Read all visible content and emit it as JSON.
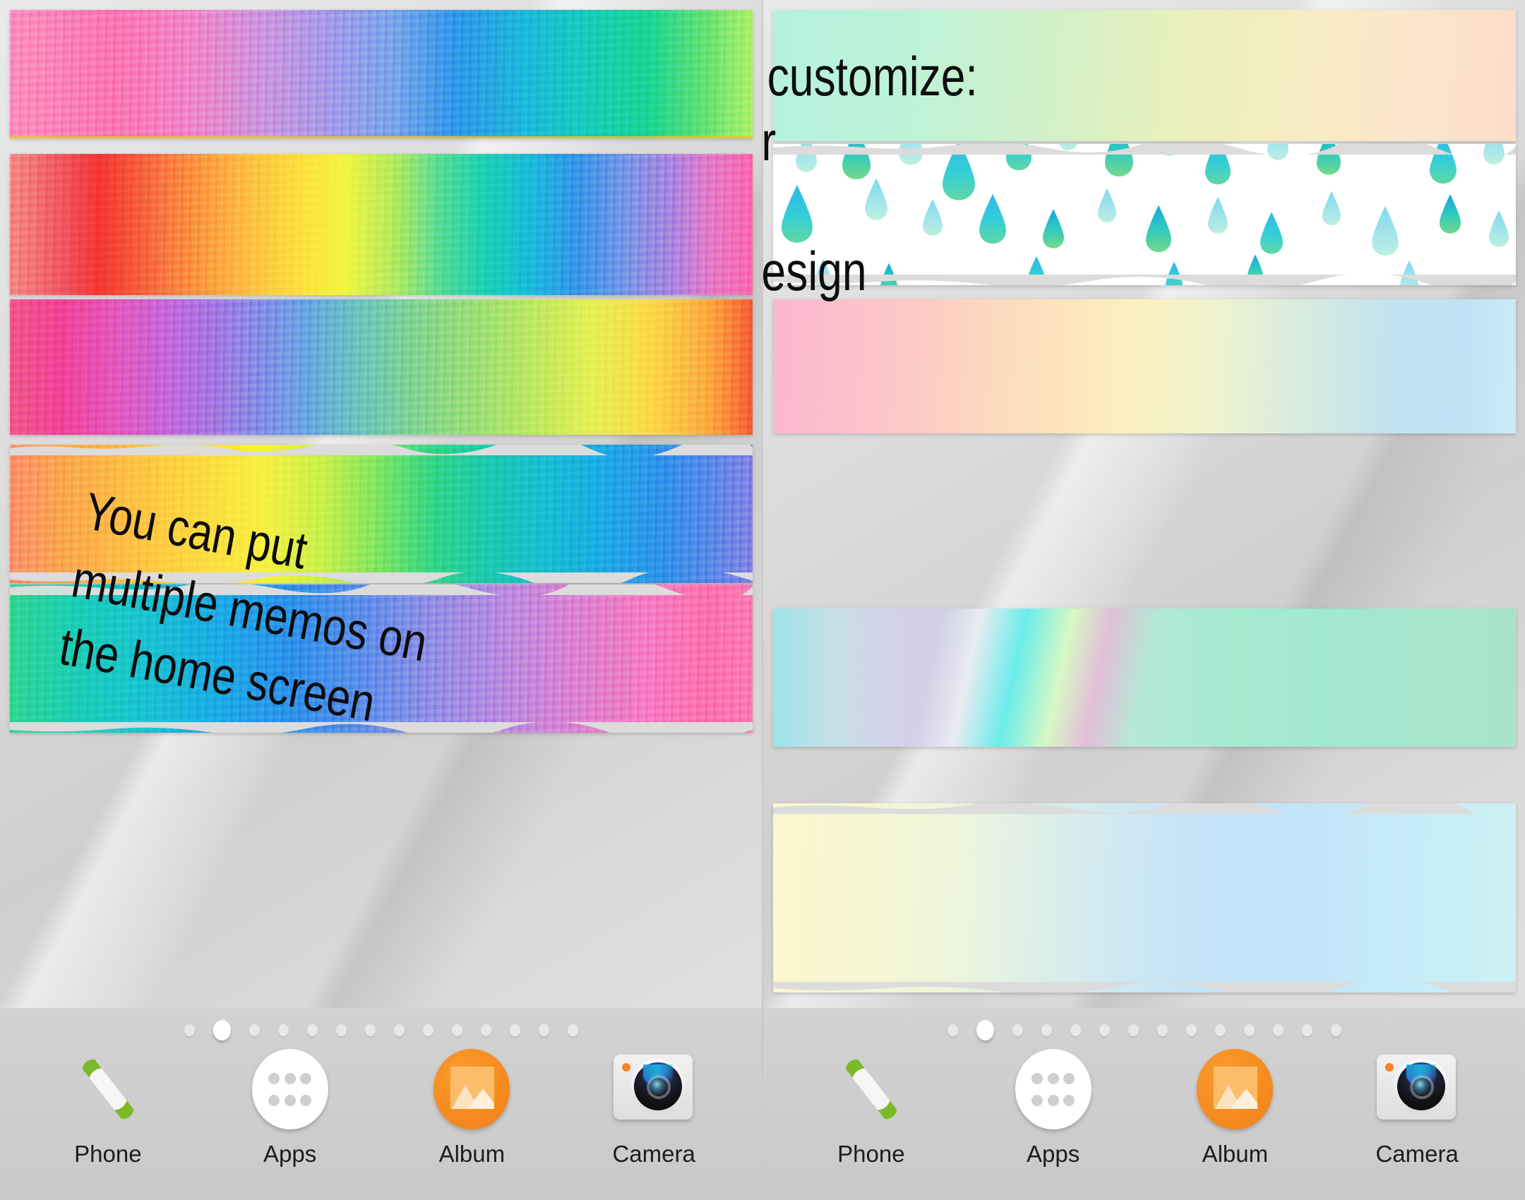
{
  "app": {
    "kind": "android-home-screen-memo-widget-promo",
    "screens": 2
  },
  "memo_texts": {
    "customize": "You can customize:\ntext color\ntext size\nborder design",
    "multiple": "You can put\nmultiple memos on\nthe home screen"
  },
  "left_screen": {
    "memos": [
      {
        "id": "memo-l1",
        "style": "watercolor-pink-purple-blue-green",
        "border": "straight"
      },
      {
        "id": "memo-l2",
        "style": "watercolor-rainbow-red-to-pink",
        "border": "straight"
      },
      {
        "id": "memo-l3",
        "style": "watercolor-pink-purple-green-yellow-red",
        "border": "straight"
      },
      {
        "id": "memo-l4",
        "style": "watercolor-orange-yellow-green-blue",
        "border": "torn"
      },
      {
        "id": "memo-l5",
        "style": "watercolor-green-blue-purple-pink",
        "border": "torn"
      }
    ],
    "page_indicator": {
      "total": 14,
      "active_index": 1
    },
    "dock": {
      "items": [
        {
          "label": "Phone",
          "icon": "phone-handset-icon"
        },
        {
          "label": "Apps",
          "icon": "apps-grid-icon"
        },
        {
          "label": "Album",
          "icon": "album-photo-icon"
        },
        {
          "label": "Camera",
          "icon": "camera-icon"
        }
      ]
    }
  },
  "right_screen": {
    "memos": [
      {
        "id": "memo-r1",
        "style": "gradient-mint-to-cream",
        "border": "straight"
      },
      {
        "id": "memo-r2",
        "style": "white-with-raindrop-pattern",
        "border": "torn"
      },
      {
        "id": "memo-r3",
        "style": "pastel-pink-peach-cream-blue",
        "border": "straight"
      },
      {
        "id": "memo-r4",
        "style": "pastel-watercolor-mint-lilac-streak",
        "border": "straight"
      },
      {
        "id": "memo-r5",
        "style": "pale-yellow-to-light-blue",
        "border": "torn"
      }
    ],
    "page_indicator": {
      "total": 14,
      "active_index": 1
    },
    "dock": {
      "items": [
        {
          "label": "Phone",
          "icon": "phone-handset-icon"
        },
        {
          "label": "Apps",
          "icon": "apps-grid-icon"
        },
        {
          "label": "Album",
          "icon": "album-photo-icon"
        },
        {
          "label": "Camera",
          "icon": "camera-icon"
        }
      ]
    }
  },
  "colors": {
    "wallpaper": "#d7d7d7",
    "dock": "#cfcfcf",
    "memo_text": "#0d0d0d",
    "album_accent": "#f58a1f",
    "phone_accent": "#7ab929",
    "active_dot": "#ffffff",
    "inactive_dot": "#e8e8e8"
  }
}
